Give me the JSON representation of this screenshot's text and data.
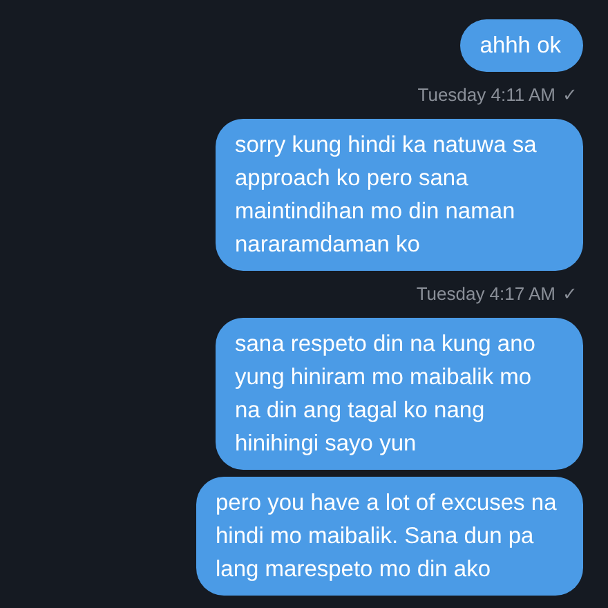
{
  "messages": [
    {
      "kind": "bubble",
      "text": "ahhh ok"
    },
    {
      "kind": "timestamp",
      "text": "Tuesday 4:11 AM",
      "receipt": "✓"
    },
    {
      "kind": "bubble",
      "text": "sorry kung hindi ka natuwa sa approach ko pero sana maintindihan mo din naman nararamdaman ko"
    },
    {
      "kind": "timestamp",
      "text": "Tuesday 4:17 AM",
      "receipt": "✓"
    },
    {
      "kind": "bubble",
      "text": "sana respeto din na kung ano yung hiniram mo maibalik mo na din ang tagal ko nang hinihingi sayo yun"
    },
    {
      "kind": "bubble",
      "text": "pero you have a lot of excuses na hindi mo maibalik. Sana dun pa lang marespeto mo din ako"
    }
  ]
}
